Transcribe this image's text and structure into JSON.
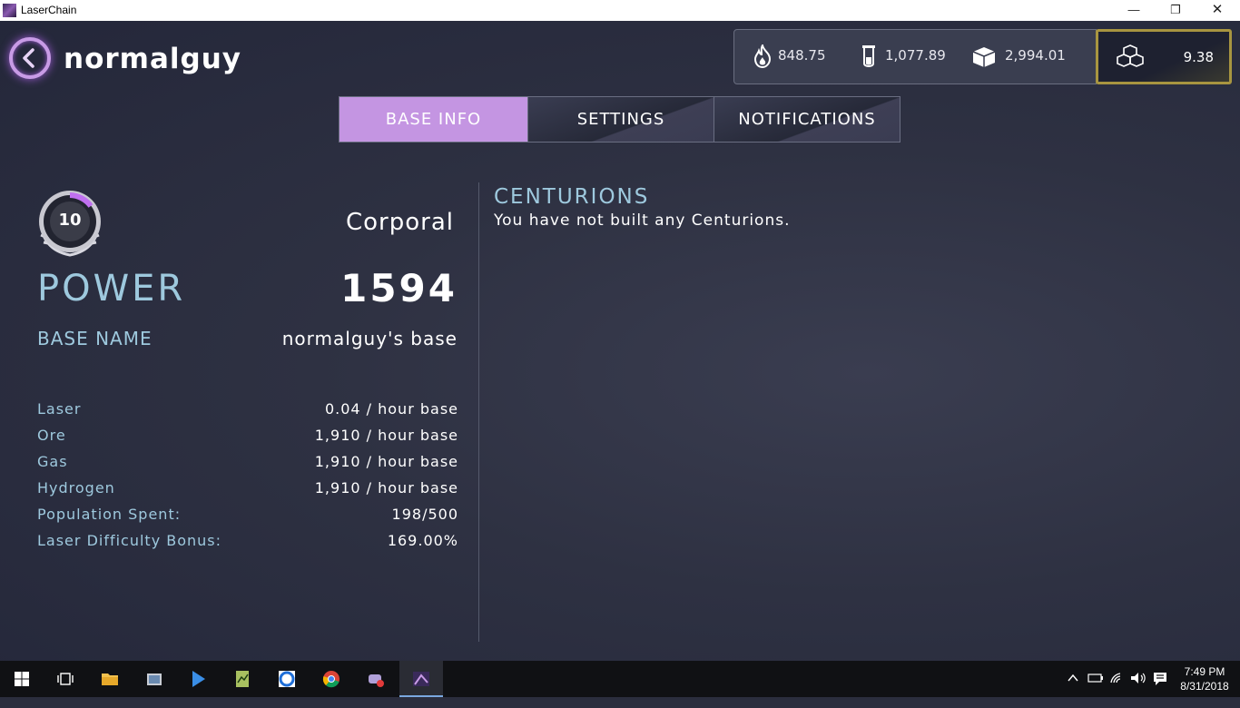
{
  "window": {
    "title": "LaserChain",
    "minimize": "—",
    "maximize": "❐",
    "close": "✕"
  },
  "header": {
    "username": "normalguy"
  },
  "resources": [
    {
      "icon": "fire-icon",
      "value": "848.75"
    },
    {
      "icon": "test-tube-icon",
      "value": "1,077.89"
    },
    {
      "icon": "crate-icon",
      "value": "2,994.01"
    }
  ],
  "laser_chain": {
    "icon": "cubes-icon",
    "value": "9.38"
  },
  "tabs": [
    {
      "label": "BASE INFO",
      "active": true
    },
    {
      "label": "SETTINGS",
      "active": false
    },
    {
      "label": "NOTIFICATIONS",
      "active": false
    }
  ],
  "profile": {
    "rank_level": "10",
    "rank_name": "Corporal",
    "power_label": "POWER",
    "power_value": "1594",
    "base_name_label": "BASE NAME",
    "base_name_value": "normalguy's base"
  },
  "stats": [
    {
      "label": "Laser",
      "value": "0.04 / hour base"
    },
    {
      "label": "Ore",
      "value": "1,910 / hour base"
    },
    {
      "label": "Gas",
      "value": "1,910 / hour base"
    },
    {
      "label": "Hydrogen",
      "value": "1,910 / hour base"
    },
    {
      "label": "Population Spent:",
      "value": "198/500"
    },
    {
      "label": "Laser Difficulty Bonus:",
      "value": "169.00%"
    }
  ],
  "centurions": {
    "title": "CENTURIONS",
    "message": "You have not built any Centurions."
  },
  "taskbar": {
    "apps": [
      "start-icon",
      "task-view-icon",
      "file-explorer-icon",
      "photos-icon",
      "play-store-icon",
      "spreadsheet-icon",
      "edge-icon",
      "chrome-icon",
      "game-bar-icon",
      "laserchain-icon"
    ],
    "time": "7:49 PM",
    "date": "8/31/2018"
  }
}
